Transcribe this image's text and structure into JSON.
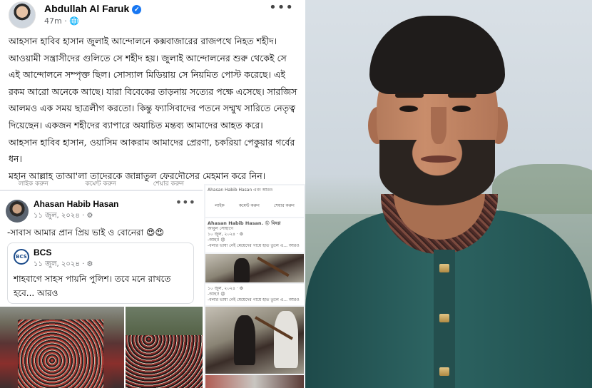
{
  "post": {
    "author": "Abdullah Al Faruk",
    "time": "47m",
    "globe": "🌐",
    "verified_icon": "✓",
    "more": "•••",
    "paragraphs": [
      "আহসান হাবিব হাসান জুলাই আন্দোলনে কক্সবাজারের রাজপথে নিহত শহীদ। আওয়ামী সন্ত্রাসীদের গুলিতে সে শহীদ হয়। জুলাই আন্দোলনের শুরু থেকেই সে এই আন্দোলনে সম্পৃক্ত ছিল। সোস্যাল মিডিয়ায় সে নিয়মিত পোস্ট করেছে। এই রকম আরো অনেকে আছে। যারা বিবেকের তাড়নায় সত্যের পক্ষে এসেছে। সারজিস আলমও এক সময় ছাত্রলীগ করতো। কিন্তু ফ্যাসিবাদের পতনে সম্মুখ সারিতে নেতৃত্ব দিয়েছেন। একজন শহীদের ব্যাপারে অযাচিত মন্তব্য আমাদের আহত করে।",
      "আহসান হাবিব হাসান, ওয়াসিম আকরাম আমাদের প্রেরণা, চকরিয়া পেকুয়ার গর্বের ধন।",
      "মহান আল্লাহ তাআ'লা তাদেরকে জান্নাতুল ফেরদৌসের মেহমান করে নিন।"
    ]
  },
  "actions": [
    "লাইক করুন",
    "কমেন্ট করুন",
    "শেয়ার করুন"
  ],
  "shared": {
    "name": "Ahasan Habib Hasan",
    "date": "১১ জুল, ২০২৪ · ⚙",
    "text": "-সাবাস আমার প্রান প্রিয় ভাই ও বোনেরা 😍😍",
    "more": "•••",
    "bcs": {
      "logo": "BCS",
      "name": "BCS",
      "date": "১১ জুল, ২০২৪ · ⚙",
      "text": "শাহবাগে সাহস পায়নি পুলিশ। তবে মনে রাখতে হবে... আরও"
    }
  },
  "mid": {
    "top_line": "Ahasan Habib Hasan এবং আরও",
    "actions": [
      "লাইক",
      "কমেন্ট করুন",
      "শেয়ার করুন"
    ],
    "name": "Ahasan Habib Hasan. 😟 বিষণ্ণ",
    "sub": "আবুল সোহাগে",
    "date": "১০ জুল, ২০২৪ · ⚙",
    "text1": "-আহা! 😞",
    "caption1": "-বলার ভাষা নেই মেয়েদের গায়ে হাত তুলে এ... আরও",
    "date2": "১০ জুল, ২০২৪ · ⚙",
    "text2": "-আহা! 😞",
    "caption2": "-বলার ভাষা নেই মেয়েদের গায়ে হাত তুলে এ... আরও"
  }
}
